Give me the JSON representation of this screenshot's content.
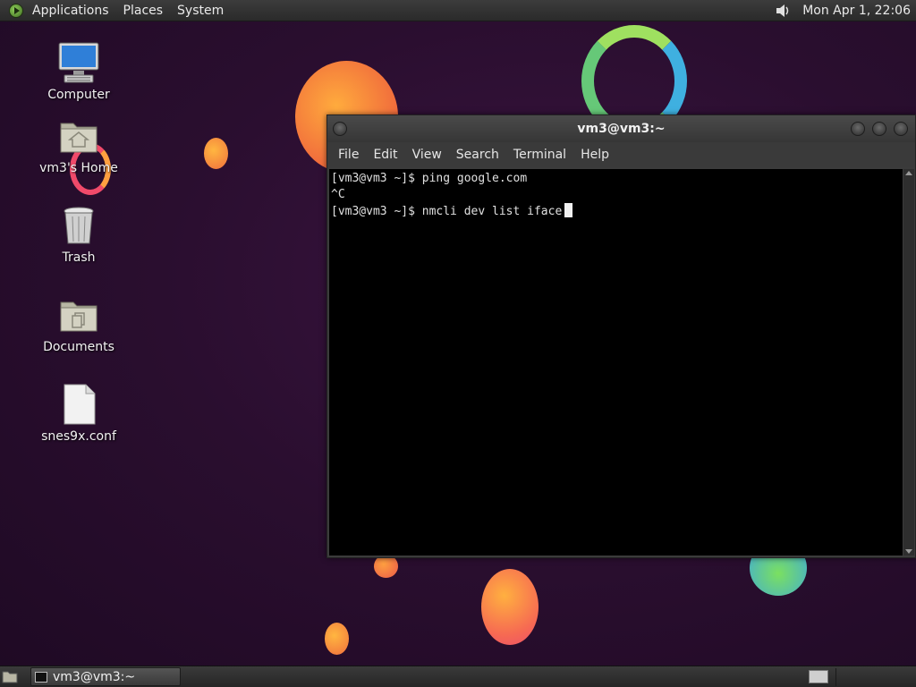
{
  "top_panel": {
    "menus": [
      "Applications",
      "Places",
      "System"
    ],
    "clock": "Mon Apr 1, 22:06",
    "volume_icon": "speaker-icon"
  },
  "desktop": {
    "icons": [
      {
        "label": "Computer",
        "icon": "computer-icon"
      },
      {
        "label": "vm3's Home",
        "icon": "home-folder-icon"
      },
      {
        "label": "Trash",
        "icon": "trash-icon"
      },
      {
        "label": "Documents",
        "icon": "documents-folder-icon"
      },
      {
        "label": "snes9x.conf",
        "icon": "file-icon"
      }
    ]
  },
  "terminal": {
    "title": "vm3@vm3:~",
    "menu": [
      "File",
      "Edit",
      "View",
      "Search",
      "Terminal",
      "Help"
    ],
    "lines": [
      "[vm3@vm3 ~]$ ping google.com",
      "^C",
      "[vm3@vm3 ~]$ nmcli dev list iface"
    ]
  },
  "taskbar": {
    "task_label": "vm3@vm3:~"
  },
  "colors": {
    "desktop_bg": "#2a0f2e",
    "terminal_bg": "#000000",
    "panel_bg": "#2e2e2e"
  }
}
